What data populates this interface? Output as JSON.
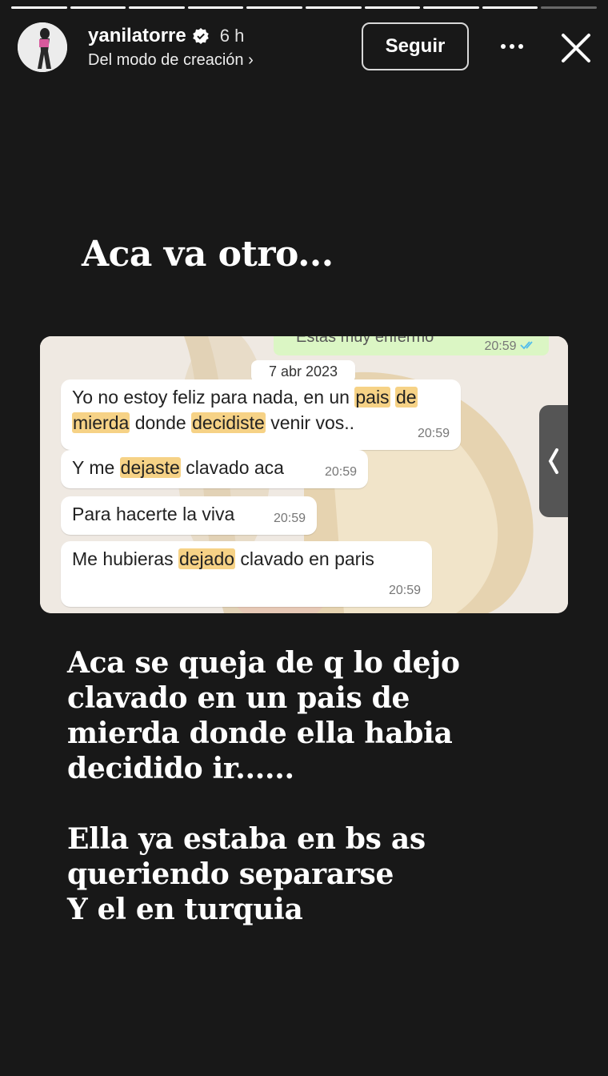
{
  "story": {
    "segments_total": 10,
    "segments_done": 9
  },
  "header": {
    "username": "yanilatorre",
    "time_ago": "6 h",
    "subtitle": "Del modo de creación",
    "follow_label": "Seguir"
  },
  "caption_top": "Aca va otro...",
  "chat": {
    "date": "7 abr 2023",
    "prev_message_partial": "Estas muy enfermo",
    "prev_time": "20:59",
    "messages": [
      {
        "parts": [
          {
            "text": "Yo no estoy feliz para nada, en un ",
            "hl": false
          },
          {
            "text": "pais",
            "hl": true
          },
          {
            "text": " ",
            "hl": false
          },
          {
            "text": "de",
            "hl": true
          },
          {
            "text": "\n",
            "hl": false
          },
          {
            "text": "mierda",
            "hl": true
          },
          {
            "text": " donde ",
            "hl": false
          },
          {
            "text": "decidiste",
            "hl": true
          },
          {
            "text": " venir vos..",
            "hl": false
          }
        ],
        "time": "20:59"
      },
      {
        "parts": [
          {
            "text": "Y me ",
            "hl": false
          },
          {
            "text": "dejaste",
            "hl": true
          },
          {
            "text": " clavado aca",
            "hl": false
          }
        ],
        "time": "20:59"
      },
      {
        "parts": [
          {
            "text": "Para hacerte la viva",
            "hl": false
          }
        ],
        "time": "20:59"
      },
      {
        "parts": [
          {
            "text": "Me hubieras ",
            "hl": false
          },
          {
            "text": "dejado",
            "hl": true
          },
          {
            "text": " clavado en paris",
            "hl": false
          }
        ],
        "time": "20:59"
      }
    ]
  },
  "caption_bottom": "Aca se queja de q lo dejo\nclavado en un pais de\nmierda donde ella habia\ndecidido ir......\n\nElla ya estaba en bs as\nqueriendo separarse\nY el en turquia",
  "colors": {
    "background": "#181818",
    "highlight": "#f6d286",
    "outgoing_bubble": "#dbf6c4",
    "check_blue": "#53bdeb"
  }
}
